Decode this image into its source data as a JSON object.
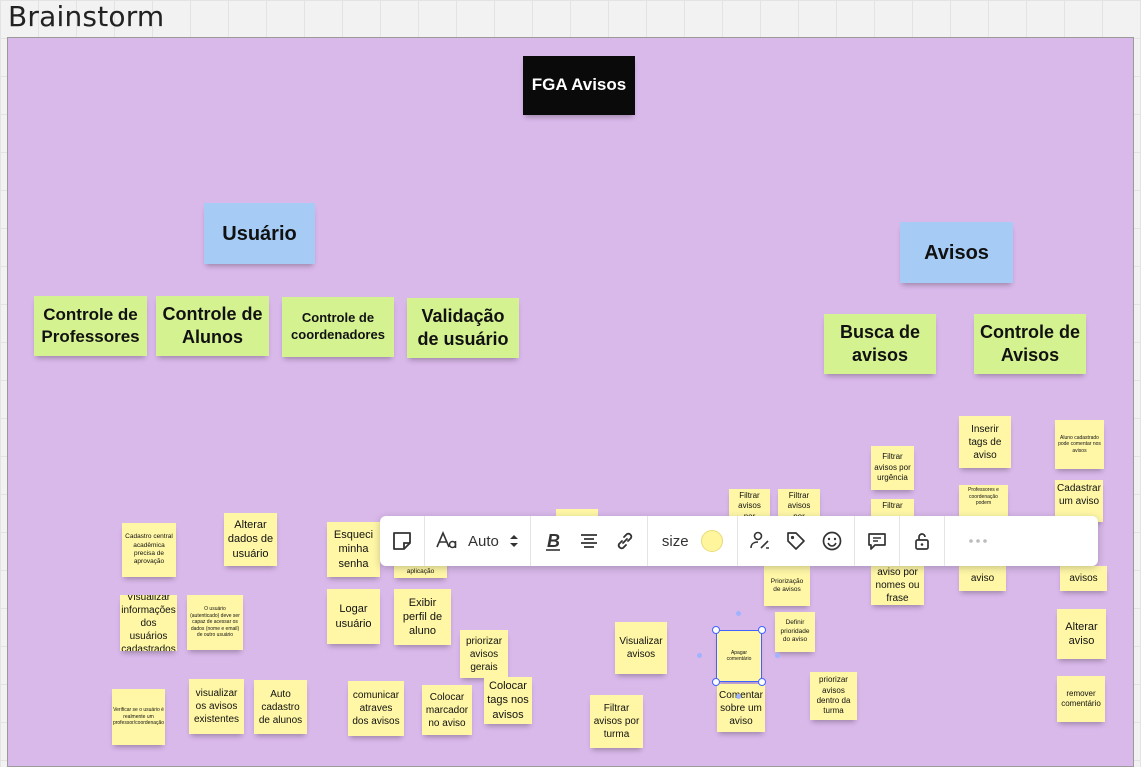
{
  "board": {
    "title": "Brainstorm"
  },
  "header_note": "FGA Avisos",
  "categories": {
    "usuario": "Usuário",
    "avisos": "Avisos"
  },
  "groups": {
    "controle_professores": "Controle de Professores",
    "controle_alunos": "Controle de Alunos",
    "controle_coordenadores": "Controle de coordenadores",
    "validacao_usuario": "Validação de usuário",
    "busca_avisos": "Busca de avisos",
    "controle_avisos": "Controle de Avisos"
  },
  "notes": {
    "cadastro_central": "Cadastro central acadêmica precisa de aprovação",
    "alterar_dados": "Alterar dados de usuário",
    "esqueci_senha": "Esqueci minha senha",
    "visualizar_info": "Visualizar informações dos usuários cadastrados",
    "usuario_autenticado": "O usuário (autenticado) deve ser capaz de acessar os dados (nome e email) de outro usuário",
    "logar_usuario": "Logar usuário",
    "exibir_perfil": "Exibir perfil de aluno",
    "aplicacao_partial": "aplicação",
    "priorizar_gerais": "priorizar avisos gerais",
    "visualizar_avisos": "Visualizar avisos",
    "verificar_usuario": "Verificar se o usuário é realmente um professor/coordenação",
    "visualizar_existentes": "visualizar os avisos existentes",
    "auto_cadastro": "Auto cadastro de alunos",
    "comunicar_avisos": "comunicar atraves dos avisos",
    "colocar_marcador": "Colocar marcador no aviso",
    "colocar_tags": "Colocar tags nos avisos",
    "filtrar_turma": "Filtrar avisos por turma",
    "filtrar_por_1": "Filtrar avisos por",
    "filtrar_por_2": "Filtrar avisos por",
    "filtrar_urgencia": "Filtrar avisos por urgência",
    "filtrar_partial": "Filtrar",
    "inserir_tags": "Inserir tags de aviso",
    "prof_coord": "Professores e coordenação podem",
    "aluno_cadastrado": "Aluno cadastrado pode comentar nos avisos",
    "cadastrar_aviso": "Cadastrar um aviso",
    "priorizacao": "Priorização de avisos",
    "aviso_nomes": "aviso por nomes ou frase",
    "aviso_partial": "aviso",
    "avisos_partial": "avisos",
    "definir_prioridade": "Definir prioridade do aviso",
    "apagar_comentario": "Apagar comentário",
    "comentar_aviso": "Comentar sobre um aviso",
    "priorizar_turma": "priorizar avisos dentro da turma",
    "alterar_aviso": "Alterar aviso",
    "remover_comentario": "remover comentário"
  },
  "toolbar": {
    "font_size_label": "Auto",
    "size_label": "size",
    "colors": {
      "note_color": "#fff59d",
      "accent": "#4262ff"
    },
    "icons": [
      "sticky-note-icon",
      "font-icon",
      "stepper-icon",
      "bold-icon",
      "align-center-icon",
      "link-icon",
      "color-swatch",
      "assign-icon",
      "tag-icon",
      "emoji-icon",
      "comment-icon",
      "lock-icon",
      "more-icon"
    ]
  }
}
